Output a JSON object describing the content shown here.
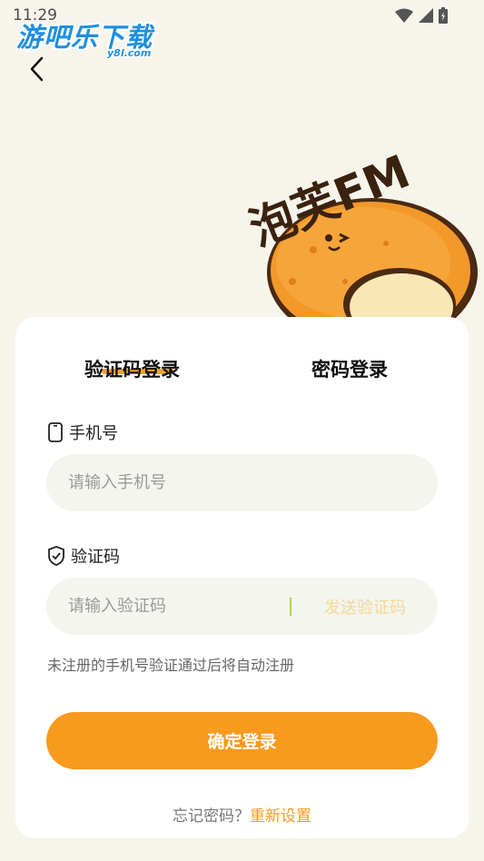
{
  "status_bar": {
    "time": "11:29"
  },
  "watermark": {
    "title": "游吧乐下载",
    "sub": "y8l.com"
  },
  "mascot": {
    "logo_text": "泡芙FM"
  },
  "tabs": [
    {
      "label": "验证码登录",
      "active": true
    },
    {
      "label": "密码登录",
      "active": false
    }
  ],
  "phone": {
    "label": "手机号",
    "placeholder": "请输入手机号"
  },
  "code": {
    "label": "验证码",
    "placeholder": "请输入验证码",
    "send_label": "发送验证码"
  },
  "hint": "未注册的手机号验证通过后将自动注册",
  "login_button": "确定登录",
  "forgot": {
    "question": "忘记密码？",
    "link": "重新设置"
  },
  "colors": {
    "accent": "#f79a1e",
    "background": "#f7f4ec",
    "input_bg": "#f3f5ee",
    "watermark_blue": "#1e8fe0"
  }
}
